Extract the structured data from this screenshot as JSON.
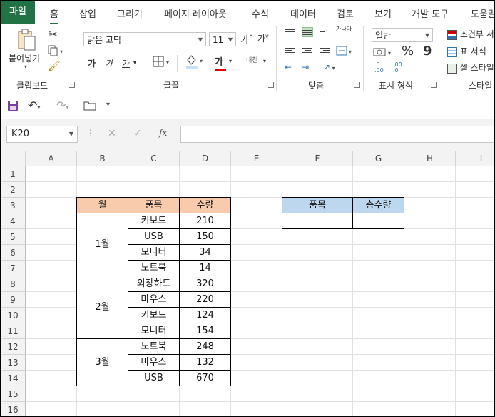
{
  "ribbon_tabs": [
    "파일",
    "홈",
    "삽입",
    "그리기",
    "페이지 레이아웃",
    "수식",
    "데이터",
    "검토",
    "보기",
    "개발 도구",
    "도움말"
  ],
  "groups": {
    "clipboard": {
      "label": "클립보드",
      "paste": "붙여넣기"
    },
    "font": {
      "label": "글꼴",
      "font_name": "맑은 고딕",
      "font_size": "11",
      "bold": "가",
      "italic": "가",
      "underline": "가",
      "grow": "가",
      "shrink": "가",
      "font_color": "가",
      "phonetic": "내천"
    },
    "alignment": {
      "label": "맞춤",
      "wrap": "가나다"
    },
    "number": {
      "label": "표시 형식",
      "format": "일반",
      "percent": "%",
      "comma": "9",
      "inc_dec": ".0",
      "inc_dec2": ".00",
      "dec_dec": ".00",
      "dec_dec2": ".0"
    },
    "styles": {
      "label": "스타일",
      "conditional": "조건부 서",
      "table": "표 서식",
      "cell": "셀 스타일"
    }
  },
  "formula_bar": {
    "name_box": "K20",
    "fx": "fx",
    "formula": ""
  },
  "columns": [
    "A",
    "B",
    "C",
    "D",
    "E",
    "F",
    "G",
    "H",
    "I"
  ],
  "rows": [
    "1",
    "2",
    "3",
    "4",
    "5",
    "6",
    "7",
    "8",
    "9",
    "10",
    "11",
    "12",
    "13",
    "14",
    "15",
    "16"
  ],
  "table1": {
    "headers": [
      "월",
      "품목",
      "수량"
    ],
    "groups": [
      {
        "month": "1월",
        "items": [
          [
            "키보드",
            "210"
          ],
          [
            "USB",
            "150"
          ],
          [
            "모니터",
            "34"
          ],
          [
            "노트북",
            "14"
          ]
        ]
      },
      {
        "month": "2월",
        "items": [
          [
            "외장하드",
            "320"
          ],
          [
            "마우스",
            "220"
          ],
          [
            "키보드",
            "124"
          ],
          [
            "모니터",
            "154"
          ]
        ]
      },
      {
        "month": "3월",
        "items": [
          [
            "노트북",
            "248"
          ],
          [
            "마우스",
            "132"
          ],
          [
            "USB",
            "670"
          ]
        ]
      }
    ]
  },
  "table2": {
    "headers": [
      "품목",
      "총수량"
    ]
  },
  "colors": {
    "excel_green": "#217346",
    "header_orange": "#F8CBAD",
    "header_blue": "#BDD7EE"
  }
}
